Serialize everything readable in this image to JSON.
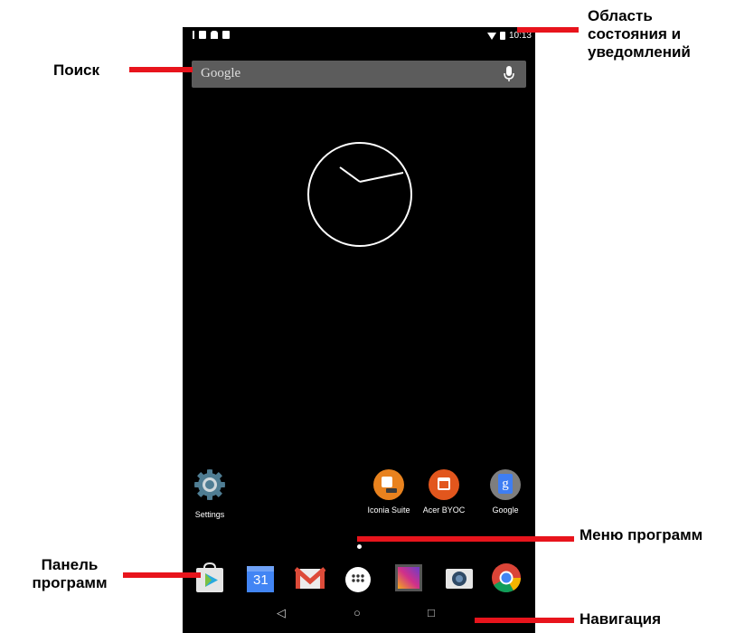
{
  "status_bar": {
    "time": "10:13"
  },
  "search": {
    "placeholder": "Google"
  },
  "apps": [
    {
      "label": "Settings"
    },
    {
      "label": "Iconia Suite"
    },
    {
      "label": "Acer BYOC"
    },
    {
      "label": "Google"
    }
  ],
  "dock": {
    "calendar_day": "31"
  },
  "navbar": {
    "back": "◁",
    "home": "○",
    "recent": "□"
  },
  "callouts": {
    "status": "Область\nсостояния и\nуведомлений",
    "search": "Поиск",
    "app_menu": "Меню программ",
    "app_panel": "Панель\nпрограмм",
    "navigation": "Навигация"
  },
  "colors": {
    "accent": "#e8141c"
  }
}
